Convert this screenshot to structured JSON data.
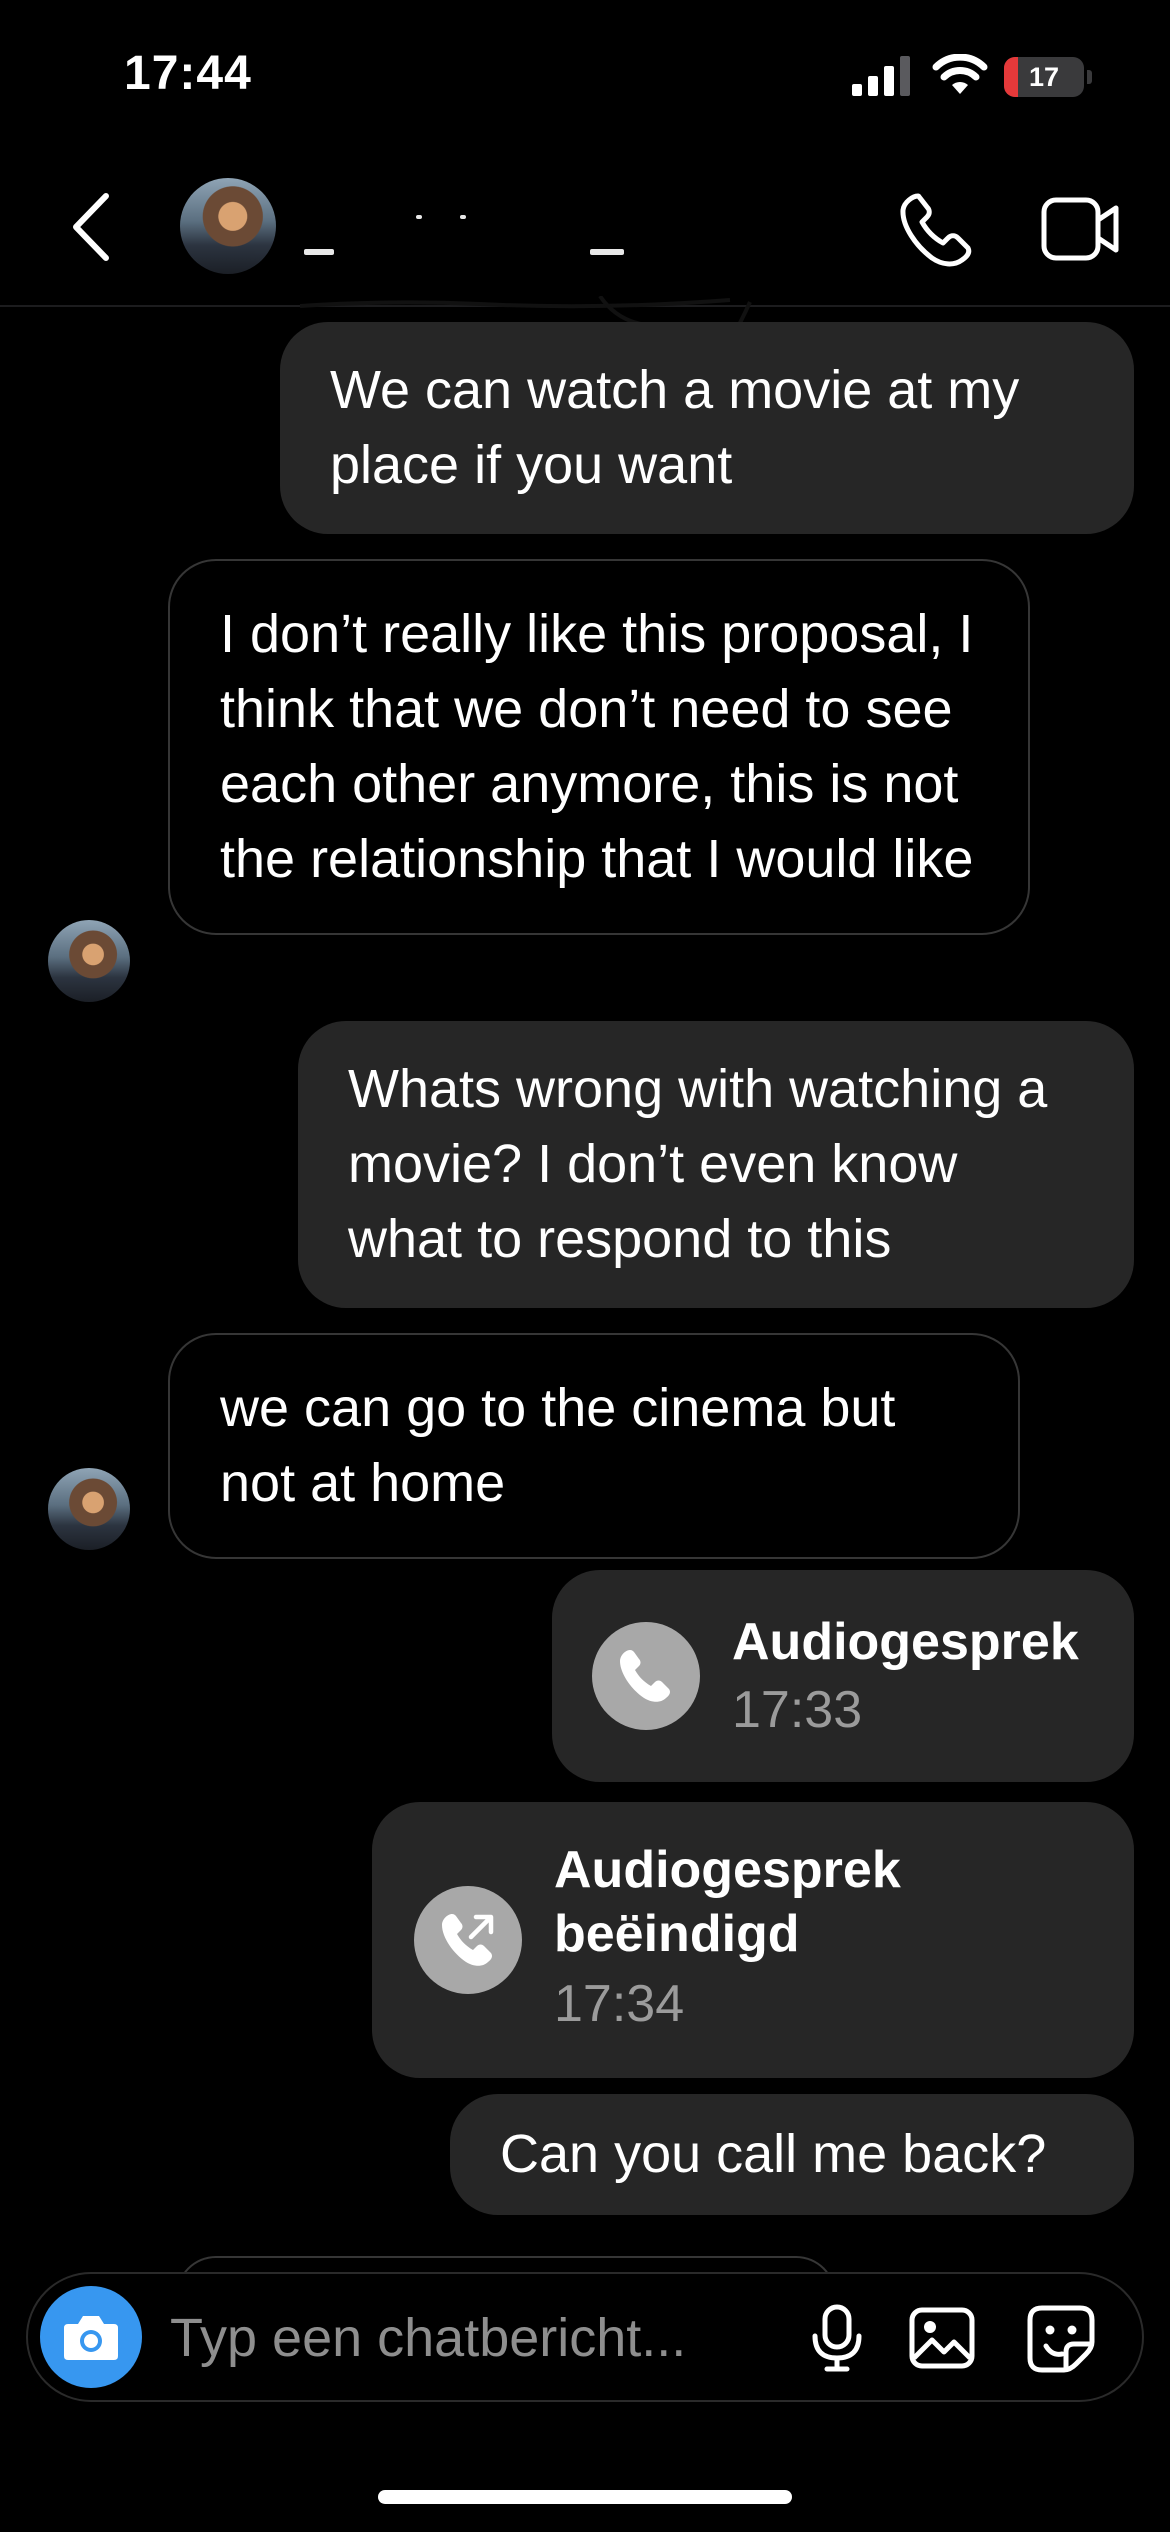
{
  "status_bar": {
    "time": "17:44",
    "battery_level": "17",
    "battery_fraction": 0.17
  },
  "header": {
    "back_icon": "chevron-left-icon",
    "call_icon": "phone-icon",
    "video_icon": "video-camera-icon"
  },
  "messages": [
    {
      "direction": "sent",
      "text": "We can watch a movie at my place if you want"
    },
    {
      "direction": "received",
      "text": "I don’t really like this proposal, I think that we don’t need to see each other anymore, this is not the relationship that I would like"
    },
    {
      "direction": "sent",
      "text": "Whats wrong with watching a movie? I don’t even know what to respond to this"
    },
    {
      "direction": "received",
      "text": "we can go to the cinema but not at home"
    },
    {
      "direction": "sent",
      "type": "call",
      "title": "Audiogesprek",
      "time": "17:33",
      "icon": "phone-icon"
    },
    {
      "direction": "sent",
      "type": "call",
      "title": "Audiogesprek beëindigd",
      "time": "17:34",
      "icon": "phone-outgoing-icon"
    },
    {
      "direction": "sent",
      "text": "Can you call me back?"
    }
  ],
  "composer": {
    "placeholder": "Typ een chatbericht...",
    "camera_icon": "camera-icon",
    "mic_icon": "microphone-icon",
    "gallery_icon": "image-icon",
    "sticker_icon": "sticker-icon"
  },
  "colors": {
    "background": "#000000",
    "sent_bubble": "#262626",
    "received_border": "#363636",
    "camera_button": "#3797f0",
    "battery_low": "#e5393a"
  }
}
